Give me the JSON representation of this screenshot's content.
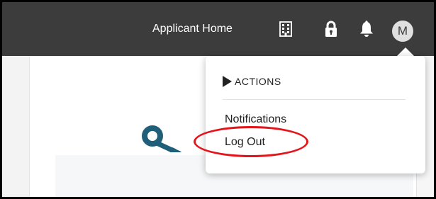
{
  "header": {
    "title": "Applicant Home",
    "icons": {
      "building": "building-icon",
      "lock": "lock-icon",
      "bell": "bell-icon"
    },
    "avatar_initial": "M"
  },
  "dropdown": {
    "section_label": "ACTIONS",
    "items": [
      {
        "label": "Notifications"
      },
      {
        "label": "Log Out"
      }
    ]
  },
  "annotation": {
    "highlighted_item": "Log Out",
    "color": "#e5141b"
  },
  "colors": {
    "topbar": "#3c3c3c",
    "key_icon": "#1f5f7a"
  }
}
